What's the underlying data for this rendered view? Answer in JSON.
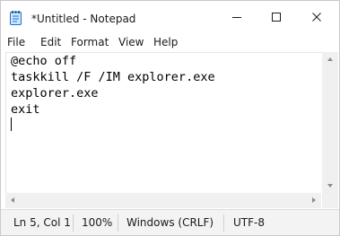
{
  "window": {
    "title": "*Untitled - Notepad"
  },
  "caption": {
    "minimize_icon": "minimize-icon",
    "maximize_icon": "maximize-icon",
    "close_icon": "close-icon"
  },
  "menu": {
    "items": [
      {
        "label": "File"
      },
      {
        "label": "Edit"
      },
      {
        "label": "Format"
      },
      {
        "label": "View"
      },
      {
        "label": "Help"
      }
    ]
  },
  "editor": {
    "lines": [
      "@echo off",
      "taskkill /F /IM explorer.exe",
      "explorer.exe",
      "exit"
    ]
  },
  "status": {
    "position": "Ln 5, Col 1",
    "zoom": "100%",
    "line_ending": "Windows (CRLF)",
    "encoding": "UTF-8"
  }
}
